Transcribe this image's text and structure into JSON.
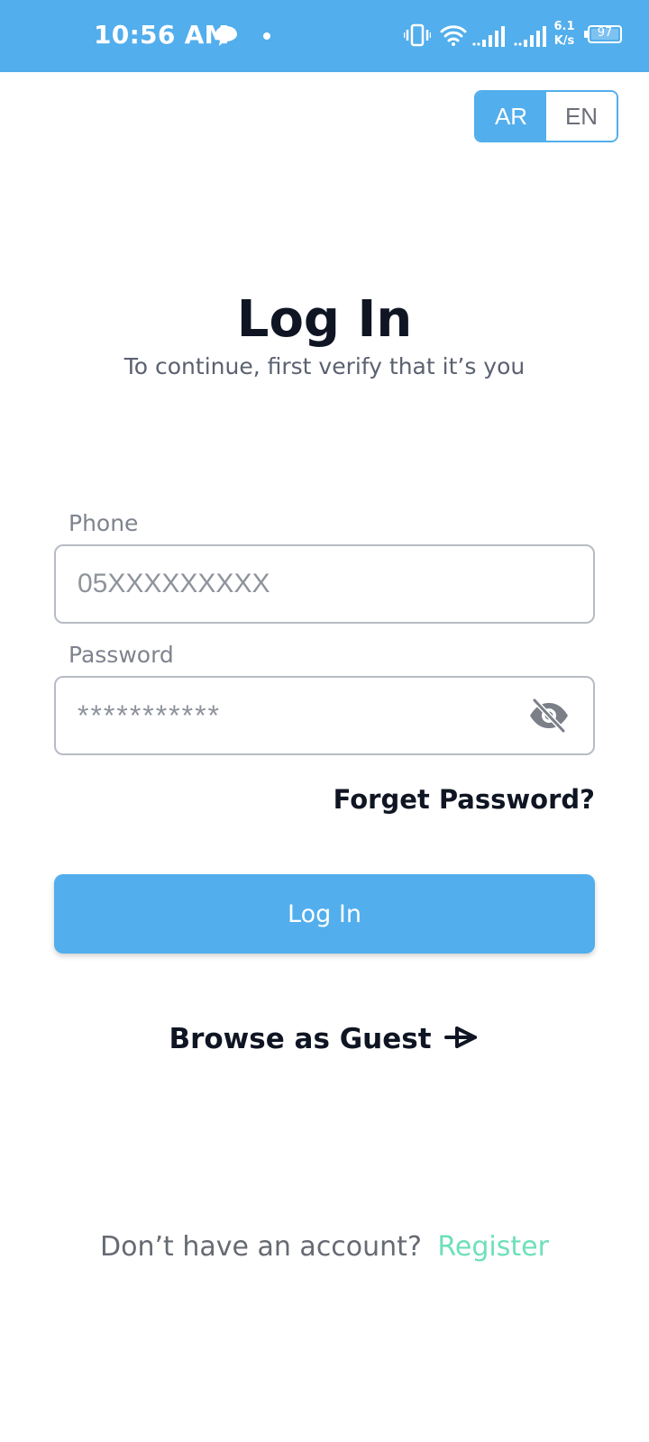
{
  "status_bar": {
    "time": "10:56 AM",
    "net_speed_value": "6.1",
    "net_speed_unit": "K/s",
    "battery": "97",
    "icons": [
      "chat-bubble-icon",
      "dot-icon",
      "vibrate-icon",
      "wifi-icon",
      "signal-icon",
      "signal-icon",
      "battery-icon"
    ]
  },
  "language_toggle": {
    "options": [
      "AR",
      "EN"
    ],
    "selected": "AR"
  },
  "header": {
    "title": "Log In",
    "subtitle": "To continue, first verify that it’s you"
  },
  "form": {
    "phone_label": "Phone",
    "phone_placeholder": "05XXXXXXXXX",
    "password_label": "Password",
    "password_placeholder": "***********",
    "forgot_password": "Forget Password?",
    "login_button": "Log In"
  },
  "guest": {
    "label": "Browse as Guest",
    "icon": "arrow-right-icon"
  },
  "register": {
    "question": "Don’t have an account?",
    "link": "Register"
  },
  "colors": {
    "primary": "#52aeec",
    "accent_register": "#6ee0b8",
    "text_dark": "#0f1523"
  }
}
